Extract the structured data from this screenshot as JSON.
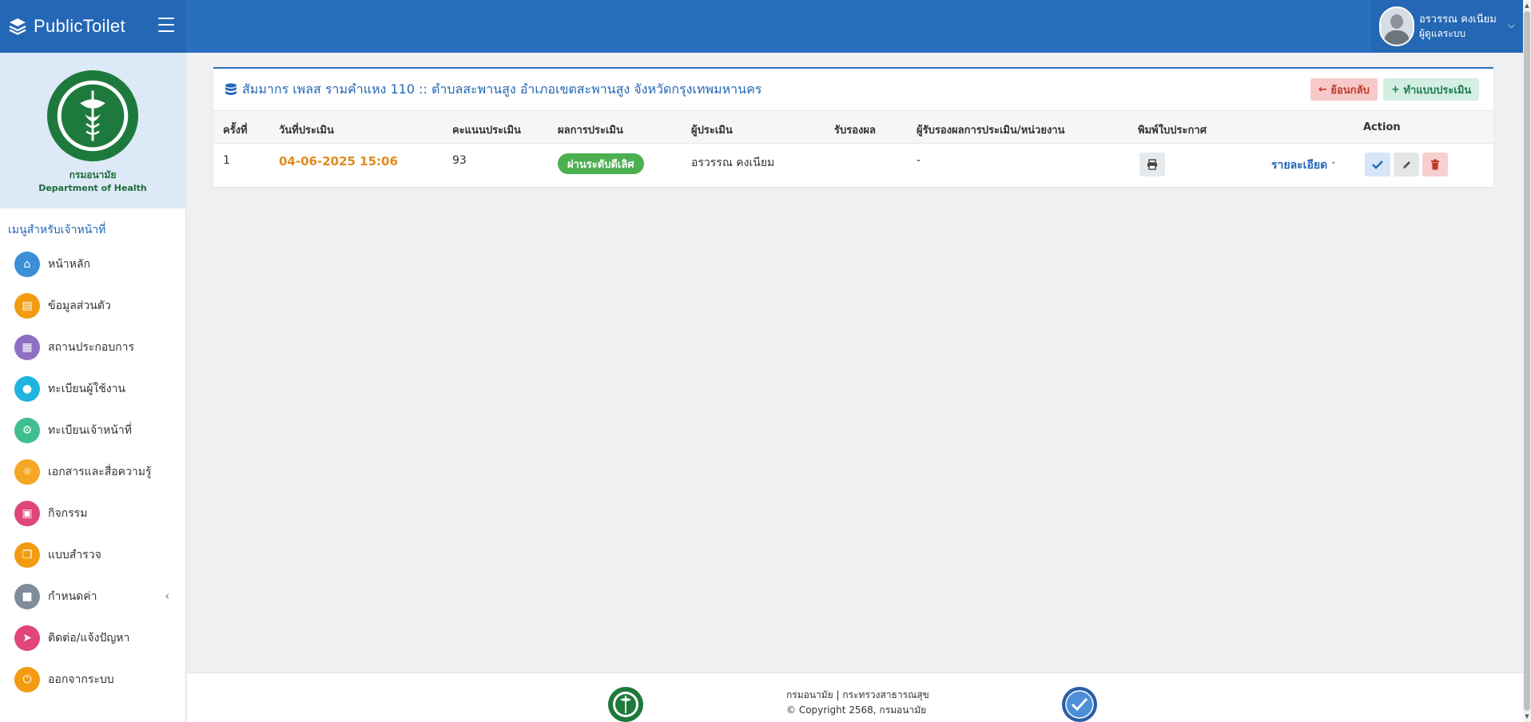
{
  "header": {
    "brand": "PublicToilet",
    "user_name": "อรวรรณ คงเนียม",
    "user_role": "ผู้ดูแลระบบ"
  },
  "sidebar": {
    "dept_th": "กรมอนามัย",
    "dept_en": "Department of Health",
    "menu_header": "เมนูสำหรับเจ้าหน้าที่",
    "items": [
      {
        "label": "หน้าหลัก",
        "icon": "home-icon",
        "color": "#3b8fd6"
      },
      {
        "label": "ข้อมูลส่วนตัว",
        "icon": "id-card-icon",
        "color": "#f39c12"
      },
      {
        "label": "สถานประกอบการ",
        "icon": "building-icon",
        "color": "#8e6fc1"
      },
      {
        "label": "ทะเบียนผู้ใช้งาน",
        "icon": "user-icon",
        "color": "#1fb4e0"
      },
      {
        "label": "ทะเบียนเจ้าหน้าที่",
        "icon": "user-gear-icon",
        "color": "#3fbf8f"
      },
      {
        "label": "เอกสารและสื่อความรู้",
        "icon": "lightbulb-icon",
        "color": "#f5a623"
      },
      {
        "label": "กิจกรรม",
        "icon": "image-icon",
        "color": "#e0457b"
      },
      {
        "label": "แบบสำรวจ",
        "icon": "clone-icon",
        "color": "#f39c12"
      },
      {
        "label": "กำหนดค่า",
        "icon": "cube-icon",
        "color": "#7f8c9a"
      },
      {
        "label": "ติดต่อ/แจ้งปัญหา",
        "icon": "megaphone-icon",
        "color": "#e0457b"
      },
      {
        "label": "ออกจากระบบ",
        "icon": "power-icon",
        "color": "#f39c12"
      }
    ]
  },
  "main": {
    "title": "สัมมากร เพลส รามคำแหง 110 :: ตำบลสะพานสูง อำเภอเขตสะพานสูง จังหวัดกรุงเทพมหานคร",
    "back_label": "ย้อนกลับ",
    "eval_label": "ทำแบบประเมิน",
    "columns": [
      "ครั้งที่",
      "วันที่ประเมิน",
      "คะแนนประเมิน",
      "ผลการประเมิน",
      "ผู้ประเมิน",
      "รับรองผล",
      "ผู้รับรองผลการประเมิน/หน่วยงาน",
      "พิมพ์ใบประกาศ",
      "",
      "Action"
    ],
    "rows": [
      {
        "no": "1",
        "date": "04-06-2025 15:06",
        "score": "93",
        "result": "ผ่านระดับดีเลิศ",
        "evaluator": "อรวรรณ คงเนียม",
        "certified": "",
        "certifier": "-",
        "detail": "รายละเอียด"
      }
    ]
  },
  "footer": {
    "line1": "กรมอนามัย | กระทรวงสาธารณสุข",
    "line2": "© Copyright 2568, กรมอนามัย"
  }
}
